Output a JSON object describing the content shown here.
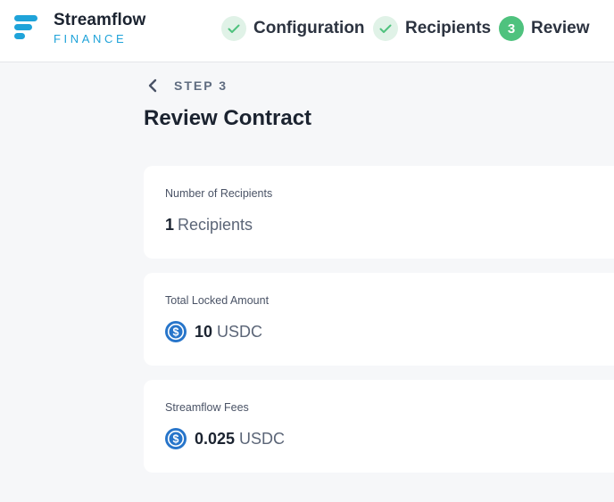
{
  "brand": {
    "name": "Streamflow",
    "sub": "FINANCE"
  },
  "steps": [
    {
      "label": "Configuration",
      "state": "done"
    },
    {
      "label": "Recipients",
      "state": "done"
    },
    {
      "label": "Review",
      "number": "3",
      "state": "active"
    }
  ],
  "nav": {
    "step_caption": "STEP 3",
    "back_icon": "chevron-left-icon"
  },
  "page_title": "Review Contract",
  "cards": [
    {
      "label": "Number of Recipients",
      "value": "1",
      "unit": "Recipients"
    },
    {
      "label": "Total Locked Amount",
      "value": "10",
      "unit": "USDC",
      "icon": "usdc-coin-icon"
    },
    {
      "label": "Streamflow Fees",
      "value": "0.025",
      "unit": "USDC",
      "icon": "usdc-coin-icon"
    }
  ],
  "colors": {
    "brand_blue": "#1fa3d9",
    "success_green": "#4fc27e",
    "success_light": "#e0f2e7",
    "usdc_blue": "#2775ca",
    "background": "#f6f7f9"
  }
}
